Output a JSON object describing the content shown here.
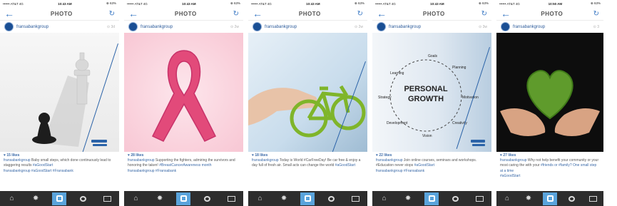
{
  "phones": [
    {
      "status": {
        "carrier": "•••••• AT&T 4G",
        "time": "10:43 AM",
        "battery": "⊕ 63%"
      },
      "nav": {
        "title": "PHOTO"
      },
      "user": {
        "name": "fransabankgroup",
        "age": "⊙ 3d"
      },
      "likes": "♥ 15 likes",
      "caption": {
        "user": "fransabankgroup",
        "text": " Baby small steps, which done continuously lead to staggering results ",
        "tags": "#aGoodStart",
        "extra": "fransabankgroup #aGoodStart #Fransabank"
      },
      "photo": {
        "word": ""
      }
    },
    {
      "status": {
        "carrier": "•••••• AT&T 4G",
        "time": "10:43 AM",
        "battery": "⊕ 63%"
      },
      "nav": {
        "title": "PHOTO"
      },
      "user": {
        "name": "fransabankgroup",
        "age": "⊙ 2w"
      },
      "likes": "♥ 28 likes",
      "caption": {
        "user": "fransabankgroup",
        "text": " Supporting the fighters, admiring the survivors and honoring the taken! ",
        "tags": "#BreastCancerAwareness month",
        "extra": "fransabankgroup #Fransabank"
      },
      "photo": {
        "word": ""
      }
    },
    {
      "status": {
        "carrier": "•••••• AT&T 4G",
        "time": "10:43 AM",
        "battery": "⊕ 63%"
      },
      "nav": {
        "title": "PHOTO"
      },
      "user": {
        "name": "fransabankgroup",
        "age": "⊙ 2w"
      },
      "likes": "♥ 18 likes",
      "caption": {
        "user": "fransabankgroup",
        "text": " Today is World #CarFreeDay! Be car free & enjoy a day full of fresh air. Small acts can change the world ",
        "tags": "#aGoodStart",
        "extra": ""
      },
      "photo": {
        "word": ""
      }
    },
    {
      "status": {
        "carrier": "•••••• AT&T 4G",
        "time": "10:43 AM",
        "battery": "⊕ 63%"
      },
      "nav": {
        "title": "PHOTO"
      },
      "user": {
        "name": "fransabankgroup",
        "age": "⊙ 3w"
      },
      "likes": "♥ 22 likes",
      "caption": {
        "user": "fransabankgroup",
        "text": " Join online courses, seminars and workshops. #Education never stops ",
        "tags": "#aGoodStart",
        "extra": "fransabankgroup #Fransabank"
      },
      "photo": {
        "word": "PERSONAL GROWTH",
        "labels": [
          "Goals",
          "Planning",
          "Learning",
          "Strategy",
          "Motivation",
          "Development",
          "Creativity",
          "Vision"
        ]
      }
    },
    {
      "status": {
        "carrier": "•••••• AT&T 4G",
        "time": "10:50 AM",
        "battery": "⊕ 63%"
      },
      "nav": {
        "title": "PHOTO"
      },
      "user": {
        "name": "fransabankgroup",
        "age": "⊙ 3"
      },
      "likes": "♥ 27 likes",
      "caption": {
        "user": "fransabankgroup",
        "text": " Why not help benefit your community or your most caring the with your ",
        "tags": "#friends or #family? One small step at a time",
        "extra": "#aGoodStart"
      },
      "photo": {
        "word": ""
      }
    }
  ],
  "colors": {
    "accent": "#3b79c4",
    "tabbar": "#2d2d2d",
    "tab_active": "#5aa4dc"
  },
  "tabs": [
    "home-icon",
    "explore-icon",
    "camera-icon",
    "activity-icon",
    "profile-icon"
  ]
}
